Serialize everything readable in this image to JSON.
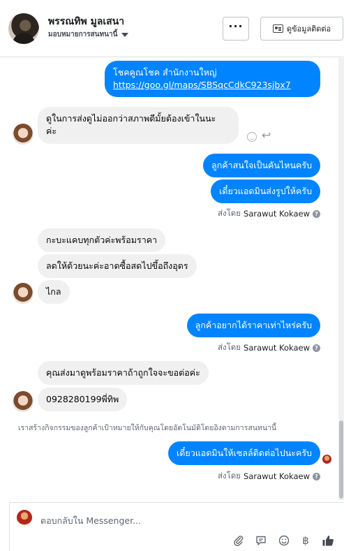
{
  "header": {
    "contact_name": "พรรณทิพ มูลเสนา",
    "assign_label": "มอบหมายการสนทนานี้",
    "more_label": "···",
    "view_contact_label": "ดูข้อมูลติดต่อ"
  },
  "messages": {
    "m1_line1": "โชคคูณโชค สำนักงานใหญ่",
    "m1_link": "https://goo.gl/maps/SBSqcCdkC923sjbx7",
    "m2_line1": "ดูในการส่งดูไม่ออกว่าสภาพดีมั้ยต้องเข้าในนะ",
    "m2_line2": "ค่ะ",
    "m3": "ลูกค้าสนใจเป็นคันไหนครับ",
    "m4": "เดี๋ยวแอดมินส่งรูปให้ครับ",
    "m5": "กะบะแคบทุกตัวค่ะพร้อมราคา",
    "m6": "ลดให้ด้วยนะค่ะอาดซื้อสดไปขึ้อถึงอุดร",
    "m7": "ไกล",
    "m8": "ลูกค้าอยากได้ราคาเท่าไหร่ครับ",
    "m9": "คุณส่งมาดูพร้อมราคาถ้าถูกใจจะขอต่อค่ะ",
    "m10": "0928280199พี่ทิพ",
    "m11": "เดี๋ยวแอดมินให้เซลล์ติดต่อไปนะครับ"
  },
  "sent_by": {
    "prefix": "ส่งโดย",
    "agent": "Sarawut Kokaew"
  },
  "system_notice": "เราสร้างกิจกรรมของลูกค้าเป้าหมายให้กับคุณโดยอัตโนมัติโดยอิงตามการสนทนานี้",
  "composer": {
    "placeholder": "ตอบกลับใน Messenger..."
  },
  "colors": {
    "outgoing_bubble": "#0084ff",
    "incoming_bubble": "#f0f0f0"
  },
  "icons": {
    "more": "ellipsis-icon",
    "contact": "contact-card-icon",
    "attach": "paperclip-icon",
    "saved_reply": "speech-bubble-icon",
    "emoji": "smiley-icon",
    "payment": "baht-icon",
    "like": "thumbs-up-icon"
  }
}
